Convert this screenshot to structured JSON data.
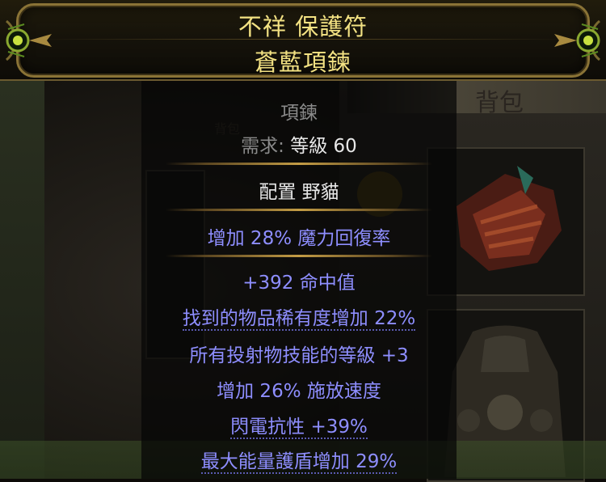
{
  "header": {
    "name": "不祥 保護符",
    "base_type": "蒼藍項鍊"
  },
  "item": {
    "item_class": "項鍊",
    "requirement_label": "需求:",
    "requirement_value": "等級 60",
    "enchant": "配置 野貓",
    "implicit": "增加 28% 魔力回復率",
    "mods": [
      "+392 命中值",
      "找到的物品稀有度增加 22%",
      "所有投射物技能的等級 +3",
      "增加 26% 施放速度",
      "閃電抗性 +39%",
      "最大能量護盾增加 29%"
    ]
  },
  "background": {
    "backpack_title": "背包",
    "backpack_small": "背包"
  },
  "colors": {
    "title": "#f3e283",
    "magic_mod": "#8e8eff",
    "header_frame": "#8a7336",
    "separator": "#c39c45"
  }
}
